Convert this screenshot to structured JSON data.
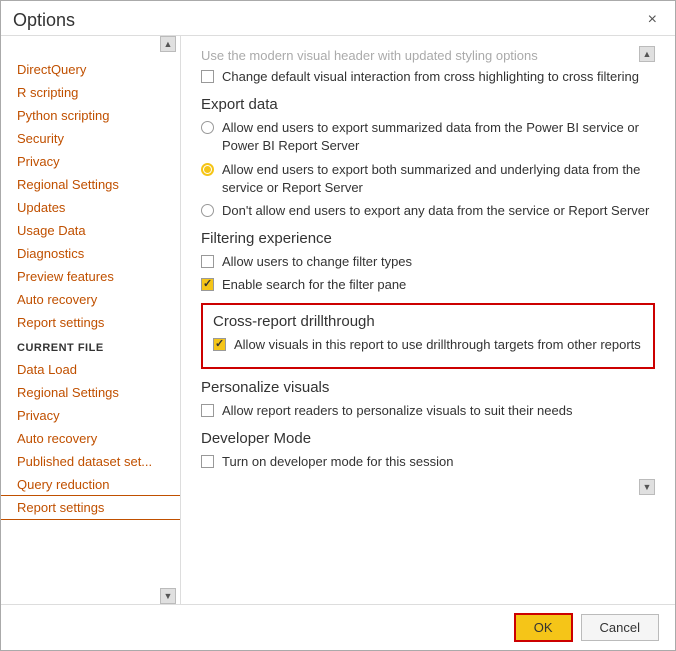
{
  "dialog": {
    "title": "Options",
    "close_label": "×"
  },
  "sidebar": {
    "global_items": [
      {
        "label": "DirectQuery",
        "id": "directquery"
      },
      {
        "label": "R scripting",
        "id": "r-scripting"
      },
      {
        "label": "Python scripting",
        "id": "python-scripting"
      },
      {
        "label": "Security",
        "id": "security"
      },
      {
        "label": "Privacy",
        "id": "privacy"
      },
      {
        "label": "Regional Settings",
        "id": "regional-settings-global"
      },
      {
        "label": "Updates",
        "id": "updates"
      },
      {
        "label": "Usage Data",
        "id": "usage-data"
      },
      {
        "label": "Diagnostics",
        "id": "diagnostics"
      },
      {
        "label": "Preview features",
        "id": "preview-features"
      },
      {
        "label": "Auto recovery",
        "id": "auto-recovery-global"
      },
      {
        "label": "Report settings",
        "id": "report-settings-global"
      }
    ],
    "current_file_header": "CURRENT FILE",
    "current_file_items": [
      {
        "label": "Data Load",
        "id": "data-load"
      },
      {
        "label": "Regional Settings",
        "id": "regional-settings-file"
      },
      {
        "label": "Privacy",
        "id": "privacy-file"
      },
      {
        "label": "Auto recovery",
        "id": "auto-recovery-file"
      },
      {
        "label": "Published dataset set...",
        "id": "published-dataset"
      },
      {
        "label": "Query reduction",
        "id": "query-reduction"
      },
      {
        "label": "Report settings",
        "id": "report-settings-file",
        "selected": true
      }
    ]
  },
  "main": {
    "faded_top_text": "Use the modern visual header with updated styling options",
    "sections": [
      {
        "id": "export-data",
        "title": "Export data",
        "options": [
          {
            "type": "radio",
            "checked": false,
            "label": "Allow end users to export summarized data from the Power BI service or Power BI Report Server"
          },
          {
            "type": "radio",
            "checked": true,
            "label": "Allow end users to export both summarized and underlying data from the service or Report Server"
          },
          {
            "type": "radio",
            "checked": false,
            "label": "Don't allow end users to export any data from the service or Report Server"
          }
        ]
      },
      {
        "id": "filtering-experience",
        "title": "Filtering experience",
        "options": [
          {
            "type": "checkbox",
            "checked": false,
            "label": "Allow users to change filter types"
          },
          {
            "type": "checkbox",
            "checked": true,
            "label": "Enable search for the filter pane"
          }
        ]
      },
      {
        "id": "cross-report-drillthrough",
        "title": "Cross-report drillthrough",
        "highlighted": true,
        "options": [
          {
            "type": "checkbox",
            "checked": true,
            "label": "Allow visuals in this report to use drillthrough targets from other reports"
          }
        ]
      },
      {
        "id": "personalize-visuals",
        "title": "Personalize visuals",
        "options": [
          {
            "type": "checkbox",
            "checked": false,
            "label": "Allow report readers to personalize visuals to suit their needs"
          }
        ]
      },
      {
        "id": "developer-mode",
        "title": "Developer Mode",
        "options": [
          {
            "type": "checkbox",
            "checked": false,
            "label": "Turn on developer mode for this session"
          }
        ]
      }
    ]
  },
  "footer": {
    "ok_label": "OK",
    "cancel_label": "Cancel"
  },
  "icons": {
    "scroll_up": "▲",
    "scroll_down": "▼",
    "close": "✕"
  }
}
